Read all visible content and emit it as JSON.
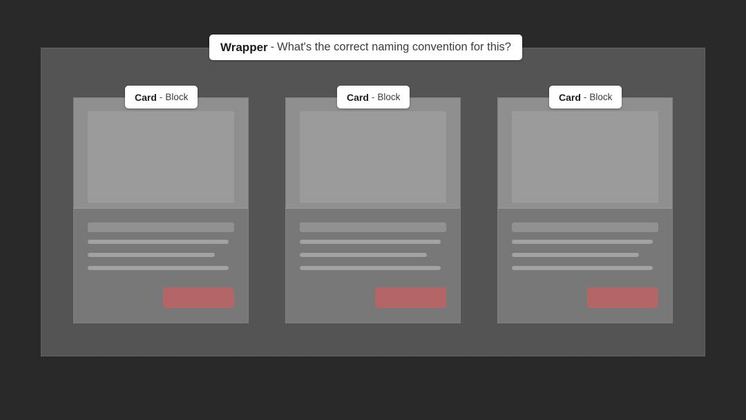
{
  "page": {
    "background_color": "#292929"
  },
  "wrapper": {
    "background_color": "#545454",
    "label": {
      "strong": "Wrapper",
      "dash": "-",
      "rest": "What's the correct naming convention for this?"
    }
  },
  "cards": [
    {
      "label": {
        "strong": "Card",
        "dash": "-",
        "rest": "Block"
      },
      "background_color": "#787878",
      "image_color": "#9b9b9b",
      "button_color": "#b46666",
      "text_lines": [
        {
          "width_percent": 96
        },
        {
          "width_percent": 87
        },
        {
          "width_percent": 96
        }
      ]
    },
    {
      "label": {
        "strong": "Card",
        "dash": "-",
        "rest": "Block"
      },
      "background_color": "#787878",
      "image_color": "#9b9b9b",
      "button_color": "#b46666",
      "text_lines": [
        {
          "width_percent": 96
        },
        {
          "width_percent": 87
        },
        {
          "width_percent": 96
        }
      ]
    },
    {
      "label": {
        "strong": "Card",
        "dash": "-",
        "rest": "Block"
      },
      "background_color": "#787878",
      "image_color": "#9b9b9b",
      "button_color": "#b46666",
      "text_lines": [
        {
          "width_percent": 96
        },
        {
          "width_percent": 87
        },
        {
          "width_percent": 96
        }
      ]
    }
  ]
}
